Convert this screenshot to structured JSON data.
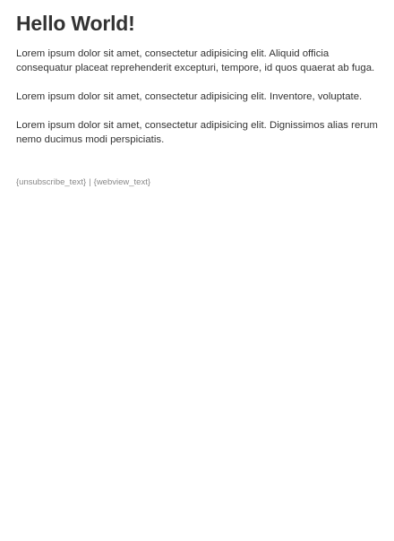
{
  "email": {
    "heading": "Hello World!",
    "paragraphs": [
      "Lorem ipsum dolor sit amet, consectetur adipisicing elit. Aliquid officia consequatur placeat reprehenderit excepturi, tempore, id quos quaerat ab fuga.",
      "Lorem ipsum dolor sit amet, consectetur adipisicing elit. Inventore, voluptate.",
      "Lorem ipsum dolor sit amet, consectetur adipisicing elit. Dignissimos alias rerum nemo ducimus modi perspiciatis."
    ],
    "footer": {
      "unsubscribe": "{unsubscribe_text}",
      "separator": "|",
      "webview": "{webview_text}"
    }
  }
}
